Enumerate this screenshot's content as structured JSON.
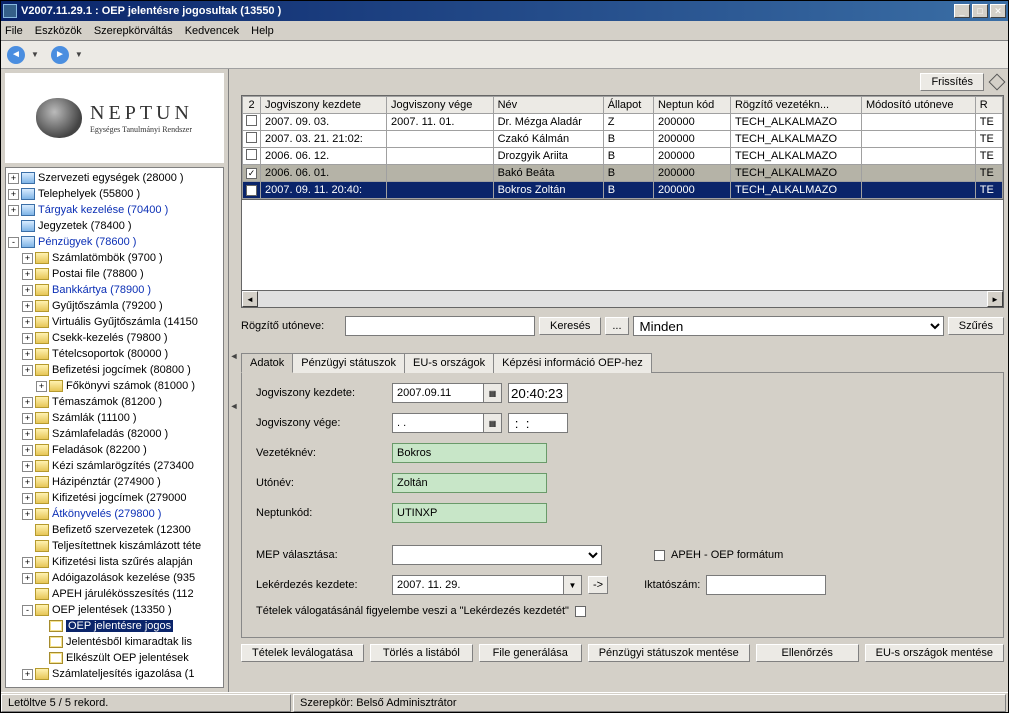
{
  "title": "V2007.11.29.1 : OEP jelentésre jogosultak (13550  )",
  "menu": [
    "File",
    "Eszközök",
    "Szerepkörváltás",
    "Kedvencek",
    "Help"
  ],
  "logo": {
    "t1": "NEPTUN",
    "t2": "Egységes Tanulmányi Rendszer"
  },
  "refresh": "Frissítés",
  "tree": [
    {
      "ind": 0,
      "exp": "+",
      "ico": "book",
      "lbl": "Szervezeti egységek (28000  )"
    },
    {
      "ind": 0,
      "exp": "+",
      "ico": "book",
      "lbl": "Telephelyek (55800  )"
    },
    {
      "ind": 0,
      "exp": "+",
      "ico": "book",
      "lbl": "Tárgyak kezelése (70400  )",
      "cls": "blue"
    },
    {
      "ind": 0,
      "exp": " ",
      "ico": "book",
      "lbl": "Jegyzetek (78400  )"
    },
    {
      "ind": 0,
      "exp": "-",
      "ico": "book",
      "lbl": "Pénzügyek (78600  )",
      "cls": "blue"
    },
    {
      "ind": 1,
      "exp": "+",
      "ico": "fold",
      "lbl": "Számlatömbök (9700  )"
    },
    {
      "ind": 1,
      "exp": "+",
      "ico": "fold",
      "lbl": "Postai file (78800  )"
    },
    {
      "ind": 1,
      "exp": "+",
      "ico": "fold",
      "lbl": "Bankkártya (78900  )",
      "cls": "blue"
    },
    {
      "ind": 1,
      "exp": "+",
      "ico": "fold",
      "lbl": "Gyűjtőszámla (79200  )"
    },
    {
      "ind": 1,
      "exp": "+",
      "ico": "fold",
      "lbl": "Virtuális Gyűjtőszámla (14150"
    },
    {
      "ind": 1,
      "exp": "+",
      "ico": "fold",
      "lbl": "Csekk-kezelés (79800  )"
    },
    {
      "ind": 1,
      "exp": "+",
      "ico": "fold",
      "lbl": "Tételcsoportok (80000  )"
    },
    {
      "ind": 1,
      "exp": "+",
      "ico": "fold",
      "lbl": "Befizetési jogcímek (80800  )"
    },
    {
      "ind": 2,
      "exp": "+",
      "ico": "fold",
      "lbl": "Főkönyvi számok (81000  )"
    },
    {
      "ind": 1,
      "exp": "+",
      "ico": "fold",
      "lbl": "Témaszámok (81200  )"
    },
    {
      "ind": 1,
      "exp": "+",
      "ico": "fold",
      "lbl": "Számlák (11100  )"
    },
    {
      "ind": 1,
      "exp": "+",
      "ico": "fold",
      "lbl": "Számlafeladás (82000  )"
    },
    {
      "ind": 1,
      "exp": "+",
      "ico": "fold",
      "lbl": "Feladások (82200  )"
    },
    {
      "ind": 1,
      "exp": "+",
      "ico": "fold",
      "lbl": "Kézi számlarögzítés (273400"
    },
    {
      "ind": 1,
      "exp": "+",
      "ico": "fold",
      "lbl": "Házipénztár (274900  )"
    },
    {
      "ind": 1,
      "exp": "+",
      "ico": "fold",
      "lbl": "Kifizetési jogcímek (279000"
    },
    {
      "ind": 1,
      "exp": "+",
      "ico": "fold",
      "lbl": "Átkönyvelés (279800  )",
      "cls": "blue"
    },
    {
      "ind": 1,
      "exp": " ",
      "ico": "fold",
      "lbl": "Befizető szervezetek (12300"
    },
    {
      "ind": 1,
      "exp": " ",
      "ico": "fold",
      "lbl": "Teljesítettnek kiszámlázott téte"
    },
    {
      "ind": 1,
      "exp": "+",
      "ico": "fold",
      "lbl": "Kifizetési lista szűrés alapján"
    },
    {
      "ind": 1,
      "exp": "+",
      "ico": "fold",
      "lbl": "Adóigazolások kezelése (935"
    },
    {
      "ind": 1,
      "exp": " ",
      "ico": "fold",
      "lbl": "APEH járulékösszesítés (112"
    },
    {
      "ind": 1,
      "exp": "-",
      "ico": "fold",
      "lbl": "OEP jelentések (13350  )"
    },
    {
      "ind": 2,
      "exp": " ",
      "ico": "doc",
      "lbl": "OEP jelentésre jogos",
      "cls": "sel"
    },
    {
      "ind": 2,
      "exp": " ",
      "ico": "doc",
      "lbl": "Jelentésből kimaradtak lis"
    },
    {
      "ind": 2,
      "exp": " ",
      "ico": "doc",
      "lbl": "Elkészült OEP jelentések"
    },
    {
      "ind": 1,
      "exp": "+",
      "ico": "fold",
      "lbl": "Számlateljesítés igazolása (1"
    }
  ],
  "cols": [
    "2",
    "Jogviszony kezdete",
    "Jogviszony vége",
    "Név",
    "Állapot",
    "Neptun kód",
    "Rögzítő vezetékn...",
    "Módosító utóneve",
    "R"
  ],
  "rows": [
    {
      "chk": "",
      "c": [
        "2007. 09. 03.",
        "2007. 11. 01.",
        "Dr. Mézga Aladár",
        "Z",
        "200000",
        "TECH_ALKALMAZO",
        "",
        "TE"
      ]
    },
    {
      "chk": "",
      "c": [
        "2007. 03. 21. 21:02:",
        "",
        "Czakó Kálmán",
        "B",
        "200000",
        "TECH_ALKALMAZO",
        "",
        "TE"
      ]
    },
    {
      "chk": "",
      "c": [
        "2006. 06. 12.",
        "",
        "Drozgyik Ariita",
        "B",
        "200000",
        "TECH_ALKALMAZO",
        "",
        "TE"
      ]
    },
    {
      "chk": "✓",
      "c": [
        "2006. 06. 01.",
        "",
        "Bakó Beáta",
        "B",
        "200000",
        "TECH_ALKALMAZO",
        "",
        "TE"
      ],
      "cls": "hl"
    },
    {
      "chk": "✓",
      "c": [
        "2007. 09. 11. 20:40:",
        "",
        "Bokros Zoltán",
        "B",
        "200000",
        "TECH_ALKALMAZO",
        "",
        "TE"
      ],
      "cls": "selrow"
    }
  ],
  "filter": {
    "lab": "Rögzítő utóneve:",
    "btnSearch": "Keresés",
    "btnMore": "...",
    "all": "Minden",
    "btnFilter": "Szűrés"
  },
  "tabs": [
    "Adatok",
    "Pénzügyi státuszok",
    "EU-s országok",
    "Képzési információ OEP-hez"
  ],
  "form": {
    "r1": {
      "lab": "Jogviszony kezdete:",
      "date": "2007.09.11",
      "time": "20:40:23"
    },
    "r2": {
      "lab": "Jogviszony vége:",
      "date": " .  .",
      "time": " :  :"
    },
    "r3": {
      "lab": "Vezetéknév:",
      "val": "Bokros"
    },
    "r4": {
      "lab": "Utónév:",
      "val": "Zoltán"
    },
    "r5": {
      "lab": "Neptunkód:",
      "val": "UTINXP"
    },
    "r6": {
      "lab": "MEP választása:"
    },
    "r7": {
      "lab": "Lekérdezés kezdete:",
      "date": "2007. 11. 29."
    },
    "apeh": "APEH - OEP formátum",
    "ikt": "Iktatószám:",
    "note": "Tételek válogatásánál figyelembe veszi a \"Lekérdezés kezdetét\""
  },
  "buttons": [
    "Tételek leválogatása",
    "Törlés a listából",
    "File generálása",
    "Pénzügyi státuszok mentése",
    "Ellenőrzés",
    "EU-s országok mentése"
  ],
  "status": {
    "left": "Letöltve 5 / 5 rekord.",
    "role": "Szerepkör: Belső Adminisztrátor"
  }
}
